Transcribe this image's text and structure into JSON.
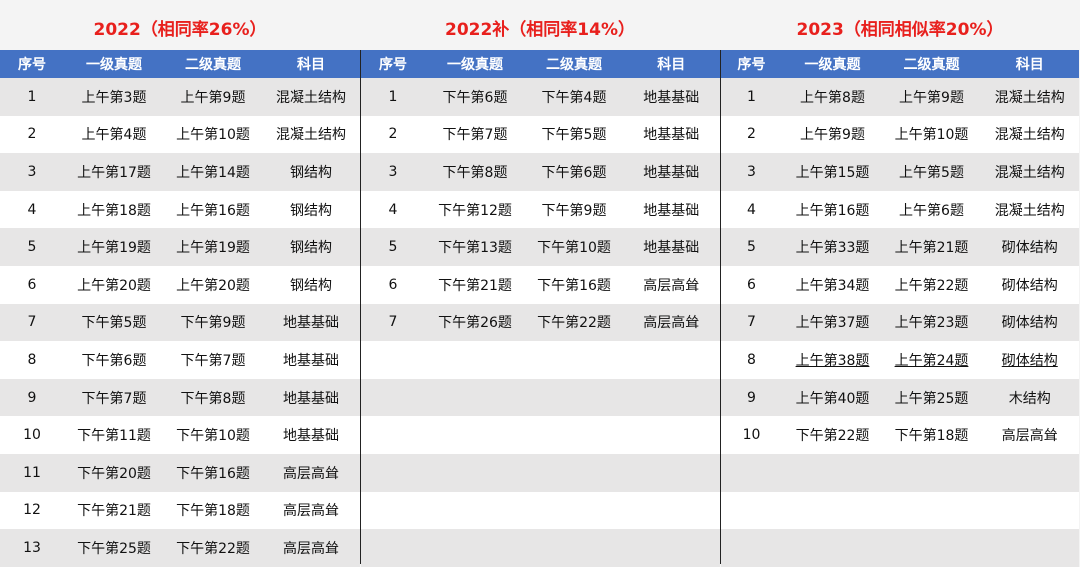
{
  "panels": [
    {
      "title": "2022（相同率26%）",
      "headers": [
        "序号",
        "一级真题",
        "二级真题",
        "科目"
      ],
      "rows": [
        [
          "1",
          "上午第3题",
          "上午第9题",
          "混凝土结构"
        ],
        [
          "2",
          "上午第4题",
          "上午第10题",
          "混凝土结构"
        ],
        [
          "3",
          "上午第17题",
          "上午第14题",
          "钢结构"
        ],
        [
          "4",
          "上午第18题",
          "上午第16题",
          "钢结构"
        ],
        [
          "5",
          "上午第19题",
          "上午第19题",
          "钢结构"
        ],
        [
          "6",
          "上午第20题",
          "上午第20题",
          "钢结构"
        ],
        [
          "7",
          "下午第5题",
          "下午第9题",
          "地基基础"
        ],
        [
          "8",
          "下午第6题",
          "下午第7题",
          "地基基础"
        ],
        [
          "9",
          "下午第7题",
          "下午第8题",
          "地基基础"
        ],
        [
          "10",
          "下午第11题",
          "下午第10题",
          "地基基础"
        ],
        [
          "11",
          "下午第20题",
          "下午第16题",
          "高层高耸"
        ],
        [
          "12",
          "下午第21题",
          "下午第18题",
          "高层高耸"
        ],
        [
          "13",
          "下午第25题",
          "下午第22题",
          "高层高耸"
        ]
      ]
    },
    {
      "title": "2022补（相同率14%）",
      "headers": [
        "序号",
        "一级真题",
        "二级真题",
        "科目"
      ],
      "rows": [
        [
          "1",
          "下午第6题",
          "下午第4题",
          "地基基础"
        ],
        [
          "2",
          "下午第7题",
          "下午第5题",
          "地基基础"
        ],
        [
          "3",
          "下午第8题",
          "下午第6题",
          "地基基础"
        ],
        [
          "4",
          "下午第12题",
          "下午第9题",
          "地基基础"
        ],
        [
          "5",
          "下午第13题",
          "下午第10题",
          "地基基础"
        ],
        [
          "6",
          "下午第21题",
          "下午第16题",
          "高层高耸"
        ],
        [
          "7",
          "下午第26题",
          "下午第22题",
          "高层高耸"
        ],
        [
          "",
          "",
          "",
          ""
        ],
        [
          "",
          "",
          "",
          ""
        ],
        [
          "",
          "",
          "",
          ""
        ],
        [
          "",
          "",
          "",
          ""
        ],
        [
          "",
          "",
          "",
          ""
        ],
        [
          "",
          "",
          "",
          ""
        ]
      ]
    },
    {
      "title": "2023（相同相似率20%）",
      "headers": [
        "序号",
        "一级真题",
        "二级真题",
        "科目"
      ],
      "rows": [
        [
          "1",
          "上午第8题",
          "上午第9题",
          "混凝土结构"
        ],
        [
          "2",
          "上午第9题",
          "上午第10题",
          "混凝土结构"
        ],
        [
          "3",
          "上午第15题",
          "上午第5题",
          "混凝土结构"
        ],
        [
          "4",
          "上午第16题",
          "上午第6题",
          "混凝土结构"
        ],
        [
          "5",
          "上午第33题",
          "上午第21题",
          "砌体结构"
        ],
        [
          "6",
          "上午第34题",
          "上午第22题",
          "砌体结构"
        ],
        [
          "7",
          "上午第37题",
          "上午第23题",
          "砌体结构"
        ],
        [
          "8",
          "上午第38题",
          "上午第24题",
          "砌体结构"
        ],
        [
          "9",
          "上午第40题",
          "上午第25题",
          "木结构"
        ],
        [
          "10",
          "下午第22题",
          "下午第18题",
          "高层高耸"
        ],
        [
          "",
          "",
          "",
          ""
        ],
        [
          "",
          "",
          "",
          ""
        ],
        [
          "",
          "",
          "",
          ""
        ]
      ]
    }
  ]
}
